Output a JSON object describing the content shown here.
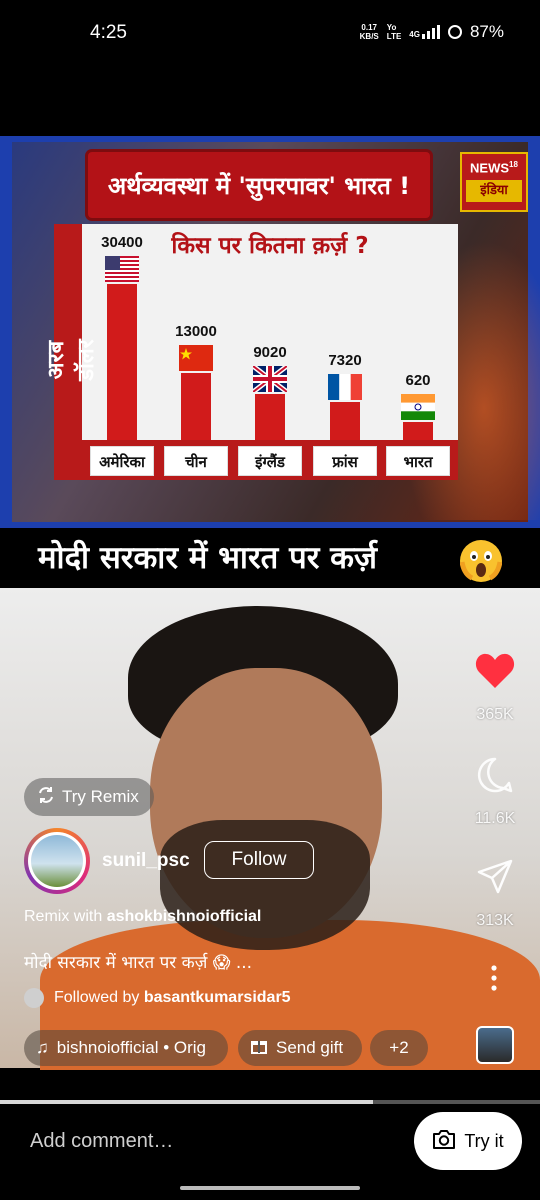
{
  "status_bar": {
    "time": "4:25",
    "net_speed_value": "0.17",
    "net_speed_unit": "KB/S",
    "volte_top": "Yo",
    "volte_bottom": "LTE",
    "network": "4G",
    "battery": "87%"
  },
  "news_graphic": {
    "headline": "अर्थव्यवस्था में 'सुपरपावर' भारत !",
    "logo_top": "NEWS",
    "logo_number": "18",
    "logo_bottom": "इंडिया",
    "y_axis_label": "अरब डॉलर",
    "chart_title": "किस पर कितना क़र्ज़ ?",
    "bars": [
      {
        "label": "अमेरिका",
        "value": 30400,
        "display": "30400",
        "flag": "usa"
      },
      {
        "label": "चीन",
        "value": 13000,
        "display": "13000",
        "flag": "china"
      },
      {
        "label": "इंग्लैंड",
        "value": 9020,
        "display": "9020",
        "flag": "uk"
      },
      {
        "label": "फ्रांस",
        "value": 7320,
        "display": "7320",
        "flag": "france"
      },
      {
        "label": "भारत",
        "value": 620,
        "display": "620",
        "flag": "india"
      }
    ]
  },
  "caption_overlay": {
    "text": "मोदी सरकार में भारत पर कर्ज़",
    "emoji": "scream-emoji"
  },
  "actions": {
    "likes": "365K",
    "comments": "11.6K",
    "shares": "313K",
    "like_color": "#ff3040"
  },
  "post": {
    "try_remix": "Try Remix",
    "username": "sunil_psc",
    "follow": "Follow",
    "remix_prefix": "Remix with ",
    "remix_user": "ashokbishnoiofficial",
    "caption": "मोदी सरकार में भारत पर कर्ज़ 😱 ...",
    "followed_prefix": "Followed by ",
    "followed_user": "basantkumarsidar5",
    "audio_chip": "bishnoiofficial • Orig",
    "gift_chip": "Send gift",
    "plus_chip": "+2"
  },
  "playback": {
    "progress": 0.69
  },
  "bottom": {
    "add_comment": "Add comment…",
    "try_it": "Try it"
  }
}
